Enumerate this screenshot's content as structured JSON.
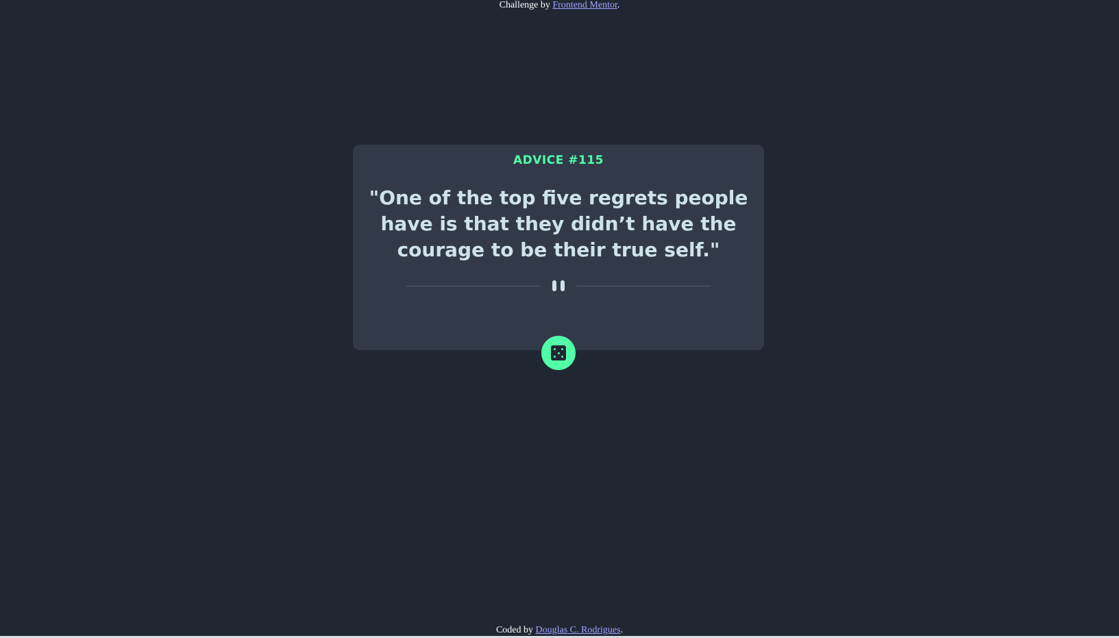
{
  "header": {
    "prefix": "Challenge by ",
    "link_text": "Frontend Mentor",
    "suffix": "."
  },
  "card": {
    "advice_label": "ADVICE #115",
    "advice_text": "\"One of the top five regrets people have is that they didn’t have the courage to be their true self.\""
  },
  "footer": {
    "prefix": "Coded by ",
    "link_text": "Douglas C. Rodrigues",
    "suffix": "."
  },
  "icons": {
    "divider_icon": "pause-icon",
    "button_icon": "dice-icon"
  },
  "colors": {
    "background": "#202733",
    "card": "#323a49",
    "accent": "#52ffa8",
    "text": "#cee3e9",
    "link": "#a0a4ff"
  }
}
